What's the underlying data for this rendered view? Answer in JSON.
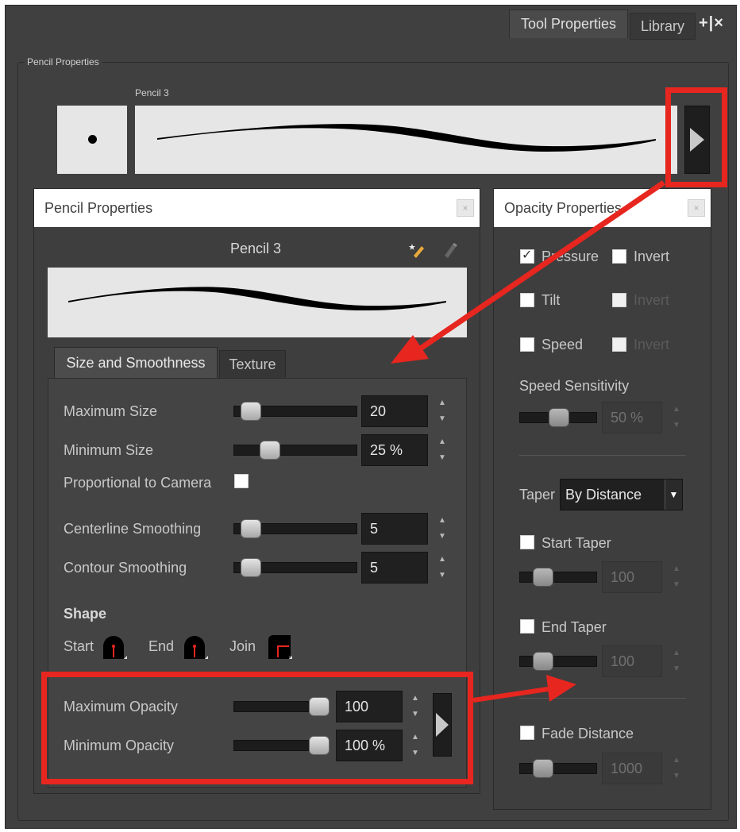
{
  "tabs": {
    "tool_properties": "Tool Properties",
    "library": "Library",
    "actions": "+|×"
  },
  "group": {
    "title": "Pencil Properties",
    "preset_name": "Pencil 3"
  },
  "pencil_dialog": {
    "title": "Pencil Properties",
    "close": "×",
    "preset_name": "Pencil 3",
    "tabs": [
      "Size and Smoothness",
      "Texture"
    ],
    "max_size": {
      "label": "Maximum Size",
      "value": "20"
    },
    "min_size": {
      "label": "Minimum Size",
      "value": "25 %"
    },
    "proportional": {
      "label": "Proportional to Camera"
    },
    "centerline": {
      "label": "Centerline Smoothing",
      "value": "5"
    },
    "contour": {
      "label": "Contour Smoothing",
      "value": "5"
    },
    "shape": {
      "title": "Shape",
      "start": "Start",
      "end": "End",
      "join": "Join"
    },
    "max_opacity": {
      "label": "Maximum Opacity",
      "value": "100"
    },
    "min_opacity": {
      "label": "Minimum Opacity",
      "value": "100 %"
    }
  },
  "opacity_dialog": {
    "title": "Opacity Properties",
    "close": "×",
    "pressure": "Pressure",
    "invert": "Invert",
    "tilt": "Tilt",
    "speed": "Speed",
    "speed_sensitivity": {
      "label": "Speed Sensitivity",
      "value": "50 %"
    },
    "taper": {
      "label": "Taper",
      "value": "By Distance"
    },
    "start_taper": {
      "label": "Start Taper",
      "value": "100"
    },
    "end_taper": {
      "label": "End Taper",
      "value": "100"
    },
    "fade_distance": {
      "label": "Fade Distance",
      "value": "1000"
    }
  },
  "colors": {
    "panel_bg": "#404040",
    "highlight": "#e6261f",
    "preview_bg": "#e6e6e6"
  }
}
